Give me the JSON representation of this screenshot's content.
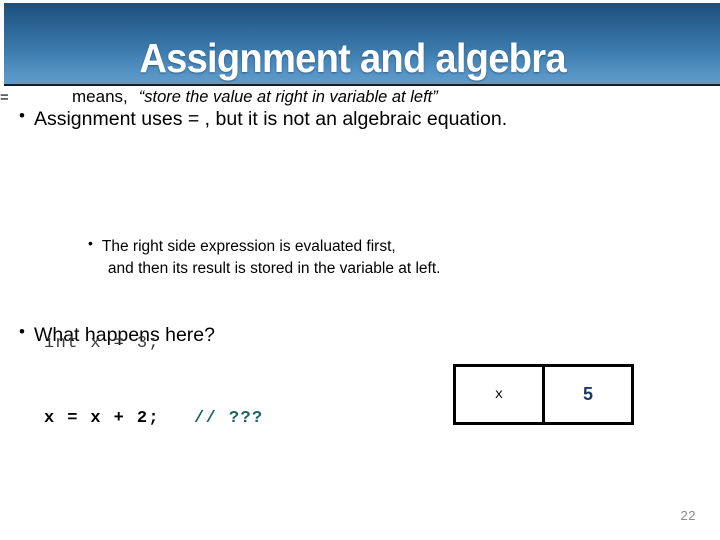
{
  "slide": {
    "title": "Assignment and algebra",
    "page_number": "22",
    "header_gradient_top": "#1d4e78",
    "header_gradient_bottom": "#5f9bc9",
    "title_color": "#ffffff"
  },
  "bullets": {
    "bullet_glyph": "•",
    "line1": "Assignment uses =  , but it is not an algebraic equation.",
    "equals_symbol": "=",
    "means_word": "means,",
    "means_quote": "“store the value at right in variable at left”",
    "sub_line_1": "The right side expression is evaluated first,",
    "sub_line_2": "and then its result is stored in the variable at left.",
    "question": "What happens here?"
  },
  "code": {
    "line1": "int x = 3;",
    "line2": "x = x + 2;",
    "comment": "// ???",
    "line1_color": "#3a3a3a",
    "line2_color": "#000000",
    "comment_color": "#1c6560"
  },
  "memory_table": {
    "variable_name": "x",
    "variable_value": "5",
    "value_color": "#1b3a63",
    "border_color": "#000000"
  }
}
